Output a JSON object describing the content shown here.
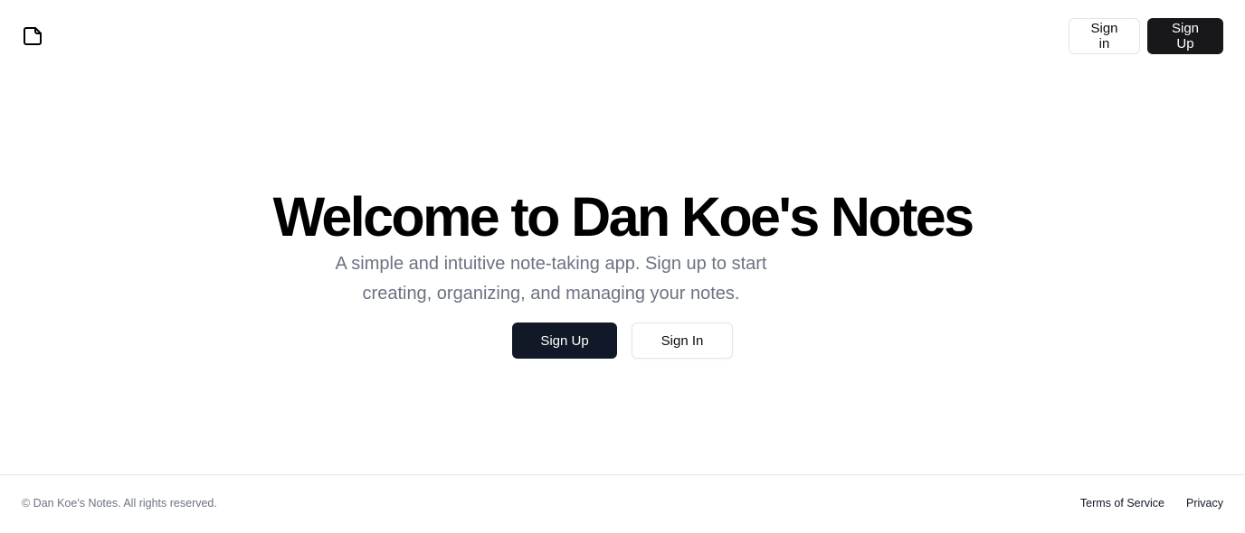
{
  "header": {
    "logo_icon": "file-icon",
    "sign_in_label": "Sign in",
    "sign_up_label": "Sign Up"
  },
  "hero": {
    "title": "Welcome to Dan Koe's Notes",
    "subtitle": "A simple and intuitive note-taking app. Sign up to start creating, organizing, and managing your notes.",
    "sign_up_label": "Sign Up",
    "sign_in_label": "Sign In"
  },
  "footer": {
    "copyright": "© Dan Koe's Notes. All rights reserved.",
    "links": [
      {
        "label": "Terms of Service"
      },
      {
        "label": "Privacy"
      }
    ]
  },
  "colors": {
    "primary_dark": "#18181b",
    "hero_button": "#111827",
    "muted_text": "#6b7280",
    "border": "#e4e4e7"
  }
}
